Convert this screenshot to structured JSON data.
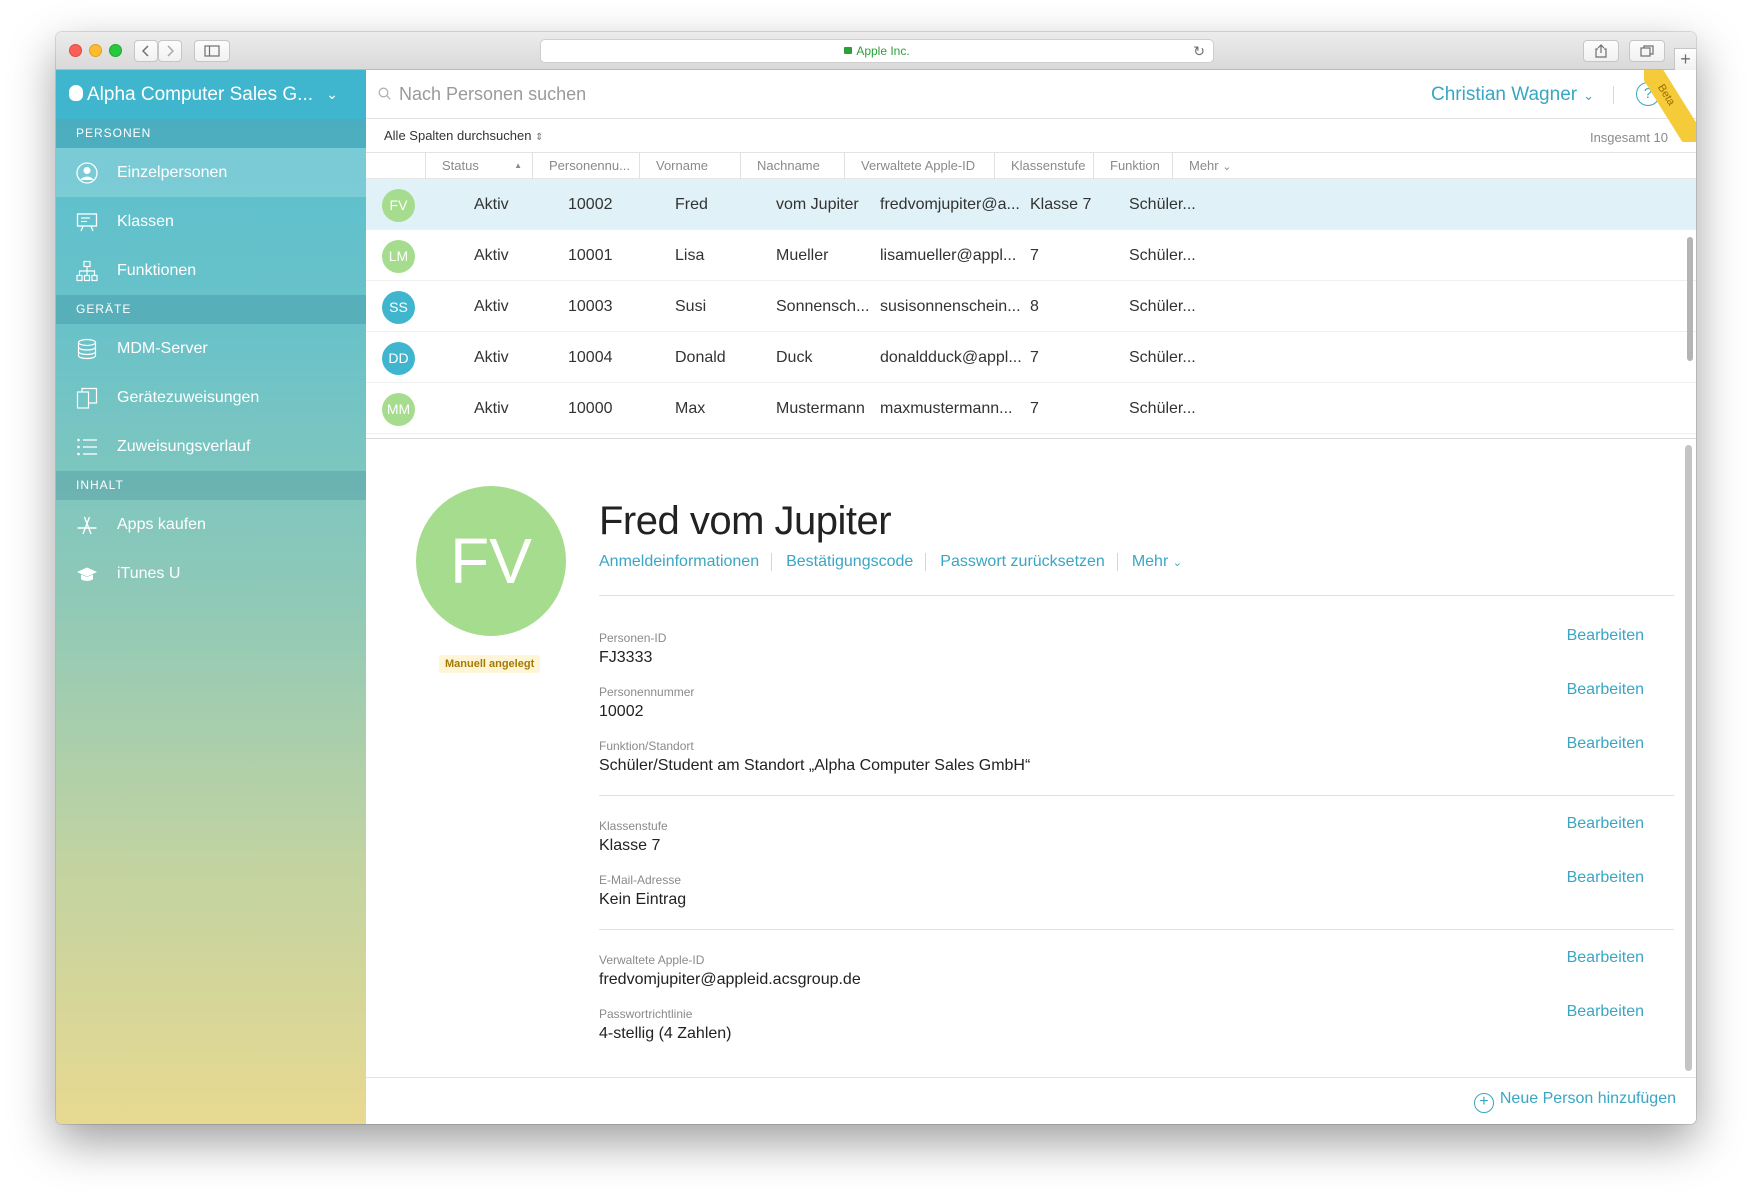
{
  "browser": {
    "address": "Apple Inc.",
    "icons": [
      "back-icon",
      "forward-icon",
      "sidebar-icon",
      "share-icon",
      "tabs-icon",
      "new-tab-icon",
      "reload-icon",
      "lock-icon"
    ],
    "new_tab_label": "+"
  },
  "sidebar": {
    "org_name": "Alpha Computer Sales G...",
    "sections": {
      "personen": "PERSONEN",
      "geraete": "GERÄTE",
      "inhalt": "INHALT"
    },
    "items": {
      "einzelpersonen": "Einzelpersonen",
      "klassen": "Klassen",
      "funktionen": "Funktionen",
      "mdm": "MDM-Server",
      "zuweisungen": "Gerätezuweisungen",
      "verlauf": "Zuweisungsverlauf",
      "apps": "Apps kaufen",
      "itunesu": "iTunes U"
    }
  },
  "topbar": {
    "search_placeholder": "Nach Personen suchen",
    "user": "Christian Wagner",
    "help": "?",
    "beta": "Beta"
  },
  "filter": {
    "scope": "Alle Spalten durchsuchen",
    "total": "Insgesamt 10"
  },
  "table": {
    "columns": {
      "status": "Status",
      "number": "Personennu...",
      "first": "Vorname",
      "last": "Nachname",
      "appleid": "Verwaltete Apple-ID",
      "grade": "Klassenstufe",
      "role": "Funktion",
      "more": "Mehr"
    },
    "rows": [
      {
        "initials": "FV",
        "status": "Aktiv",
        "number": "10002",
        "first": "Fred",
        "last": "vom Jupiter",
        "appleid": "fredvomjupiter@a...",
        "grade": "Klasse 7",
        "role": "Schüler..."
      },
      {
        "initials": "LM",
        "status": "Aktiv",
        "number": "10001",
        "first": "Lisa",
        "last": "Mueller",
        "appleid": "lisamueller@appl...",
        "grade": "7",
        "role": "Schüler..."
      },
      {
        "initials": "SS",
        "status": "Aktiv",
        "number": "10003",
        "first": "Susi",
        "last": "Sonnensch...",
        "appleid": "susisonnenschein...",
        "grade": "8",
        "role": "Schüler..."
      },
      {
        "initials": "DD",
        "status": "Aktiv",
        "number": "10004",
        "first": "Donald",
        "last": "Duck",
        "appleid": "donaldduck@appl...",
        "grade": "7",
        "role": "Schüler..."
      },
      {
        "initials": "MM",
        "status": "Aktiv",
        "number": "10000",
        "first": "Max",
        "last": "Mustermann",
        "appleid": "maxmustermann...",
        "grade": "7",
        "role": "Schüler..."
      }
    ]
  },
  "detail": {
    "initials": "FV",
    "badge": "Manuell angelegt",
    "name": "Fred vom Jupiter",
    "actions": {
      "login": "Anmeldeinformationen",
      "code": "Bestätigungscode",
      "reset": "Passwort zurücksetzen",
      "more": "Mehr"
    },
    "edit_label": "Bearbeiten",
    "fields": {
      "id_label": "Personen-ID",
      "id_value": "FJ3333",
      "num_label": "Personennummer",
      "num_value": "10002",
      "role_label": "Funktion/Standort",
      "role_value": "Schüler/Student am Standort „Alpha Computer Sales GmbH“",
      "grade_label": "Klassenstufe",
      "grade_value": "Klasse 7",
      "email_label": "E-Mail-Adresse",
      "email_value": "Kein Eintrag",
      "appleid_label": "Verwaltete Apple-ID",
      "appleid_value": "fredvomjupiter@appleid.acsgroup.de",
      "pw_label": "Passwortrichtlinie",
      "pw_value": "4-stellig (4 Zahlen)"
    }
  },
  "footer": {
    "add_label": "Neue Person hinzufügen"
  },
  "colors": {
    "accent": "#39a6c3",
    "avatar_green": "#a5dc8e",
    "avatar_blue": "#3fb6cd",
    "selected_row": "#e0f1f7"
  }
}
